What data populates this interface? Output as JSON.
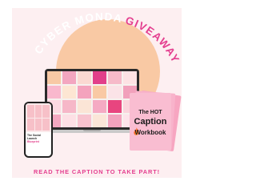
{
  "colors": {
    "background": "#ffffff",
    "panel_pink": "#fdeff1",
    "peach": "#f9c9a4",
    "accent_pink": "#e43e8f",
    "book_pink": "#f9bdd1"
  },
  "headline": {
    "word1": "CYBER MONDAY",
    "word2": "GIVEAWAY"
  },
  "laptop_tile_colors": [
    "#f8c9a5",
    "#f3a6c0",
    "#fbd9d2",
    "#e23f8a",
    "#f6bac9",
    "#fde2e4",
    "#f9b8cd",
    "#fde6d3",
    "#f4a3bd",
    "#f9c9a4",
    "#fbe3e7",
    "#f1a0bb",
    "#fcd9e2",
    "#f6b7c8",
    "#fbe5d6",
    "#f5aac3",
    "#e8457f",
    "#fbd3dc",
    "#f3a8c1",
    "#fde0e5",
    "#f8c3cf",
    "#fbe6d8",
    "#f2a2bd",
    "#fde3ea"
  ],
  "phone": {
    "title_line1": "The Social Launch",
    "title_line2": "Blueprint"
  },
  "workbook": {
    "line1": "The HOT",
    "line2": "Caption",
    "line3": "Workbook"
  },
  "footer_text": "READ THE CAPTION TO TAKE PART!"
}
